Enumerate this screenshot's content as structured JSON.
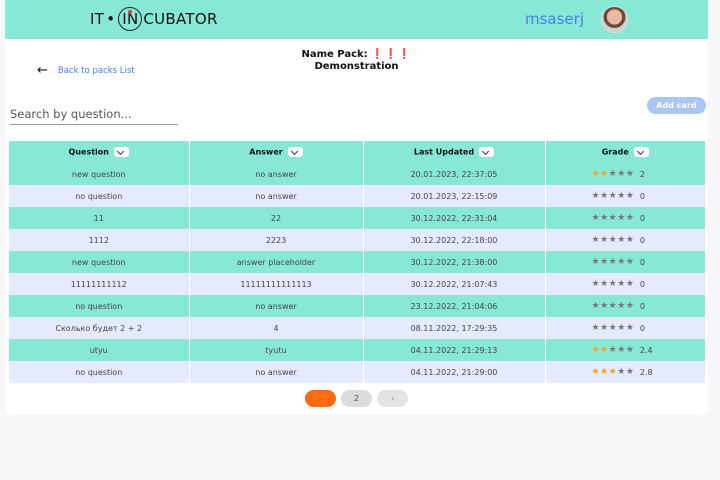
{
  "header": {
    "logo_left": "IT",
    "logo_mid": "IN",
    "logo_right": "CUBATOR",
    "user_name": "msaserj"
  },
  "pack": {
    "title_label": "Name Pack:",
    "title_excl": "❗❗❗",
    "title_name": "Demonstration"
  },
  "nav": {
    "back_label": "Back to packs List"
  },
  "search": {
    "placeholder": "Search by question...",
    "value": ""
  },
  "actions": {
    "add_card_label": "Add card"
  },
  "table": {
    "headers": [
      "Question",
      "Answer",
      "Last Updated",
      "Grade"
    ],
    "rows": [
      {
        "question": "new question",
        "answer": "no answer",
        "updated": "20.01.2023, 22:37:05",
        "grade": "2",
        "stars": 2
      },
      {
        "question": "no question",
        "answer": "no answer",
        "updated": "20.01.2023, 22:15:09",
        "grade": "0",
        "stars": 0
      },
      {
        "question": "11",
        "answer": "22",
        "updated": "30.12.2022, 22:31:04",
        "grade": "0",
        "stars": 0
      },
      {
        "question": "1112",
        "answer": "2223",
        "updated": "30.12.2022, 22:18:00",
        "grade": "0",
        "stars": 0
      },
      {
        "question": "new question",
        "answer": "answer placeholder",
        "updated": "30.12.2022, 21:38:00",
        "grade": "0",
        "stars": 0
      },
      {
        "question": "11111111112",
        "answer": "11111111111113",
        "updated": "30.12.2022, 21:07:43",
        "grade": "0",
        "stars": 0
      },
      {
        "question": "no question",
        "answer": "no answer",
        "updated": "23.12.2022, 21:04:06",
        "grade": "0",
        "stars": 0
      },
      {
        "question": "Сколько будет 2 + 2",
        "answer": "4",
        "updated": "08.11.2022, 17:29:35",
        "grade": "0",
        "stars": 0
      },
      {
        "question": "utyu",
        "answer": "tyutu",
        "updated": "04.11.2022, 21:29:13",
        "grade": "2.4",
        "stars": 2
      },
      {
        "question": "no question",
        "answer": "no answer",
        "updated": "04.11.2022, 21:29:00",
        "grade": "2.8",
        "stars": 3
      }
    ]
  },
  "pagination": {
    "pages": [
      "1",
      "2"
    ],
    "current": "1",
    "next_label": "›"
  },
  "colors": {
    "accent": "#88e8d6",
    "row_alt": "#e6eafd",
    "star_on": "#f3a51b",
    "page_active": "#ff6a13",
    "link": "#4a7fe8"
  }
}
